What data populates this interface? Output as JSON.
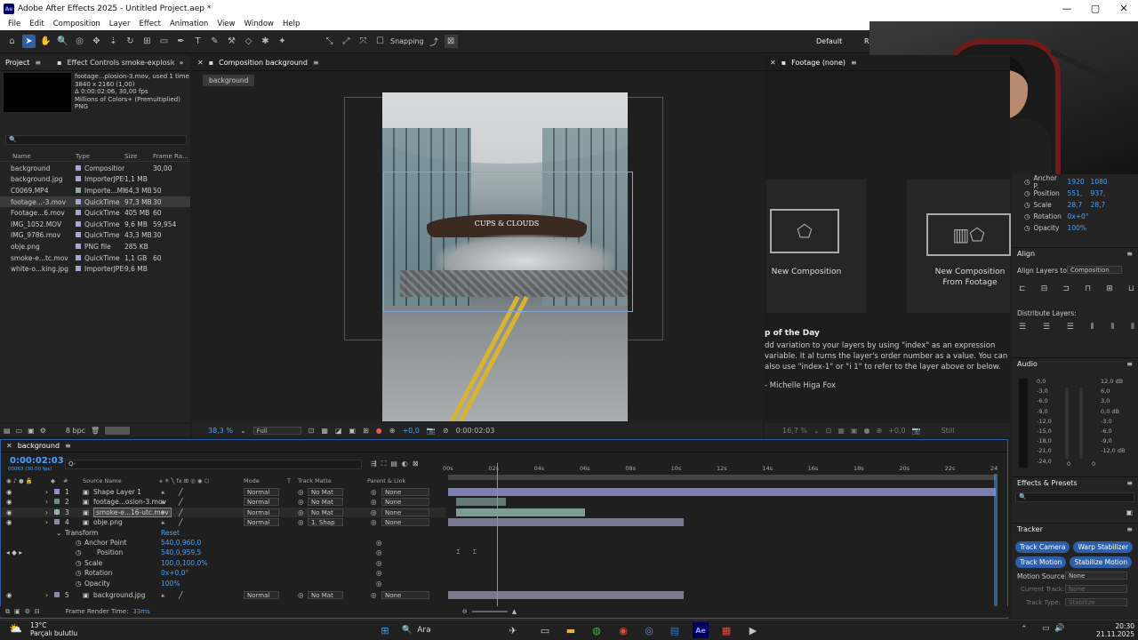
{
  "window": {
    "title": "Adobe After Effects 2025 - Untitled Project.aep *",
    "minimize": "—",
    "maximize": "▢",
    "close": "✕"
  },
  "menu": [
    "File",
    "Edit",
    "Composition",
    "Layer",
    "Effect",
    "Animation",
    "View",
    "Window",
    "Help"
  ],
  "toolbar": {
    "snapping": "Snapping",
    "workspace": "Default",
    "workspace_more": "R"
  },
  "project": {
    "tab_project": "Project",
    "tab_effects": "Effect Controls smoke-explosion-202",
    "preview_name": "footage...plosion-3.mov",
    "preview_used": ", used 1 time",
    "preview_dims": "3840 x 2160 (1,00)",
    "preview_duration": "Δ 0:00:02:06, 30,00 fps",
    "preview_colors": "Millions of Colors+ (Premultiplied)",
    "preview_format": "PNG",
    "search_placeholder": "🔍",
    "columns": [
      "Name",
      "Type",
      "Size",
      "Frame Ra..."
    ],
    "items": [
      {
        "name": "background",
        "type": "Composition",
        "size": "",
        "fps": "30,00",
        "color": "#a6a6d6"
      },
      {
        "name": "background.jpg",
        "type": "ImporterJPEG",
        "size": "1,1 MB",
        "fps": "",
        "color": "#a6a6d6"
      },
      {
        "name": "C0069.MP4",
        "type": "Importe...MEX",
        "size": "64,3 MB",
        "fps": "50",
        "color": "#8fa6a6"
      },
      {
        "name": "footage...-3.mov",
        "type": "QuickTime",
        "size": "97,3 MB",
        "fps": "30",
        "color": "#a6a6d6"
      },
      {
        "name": "Footage...6.mov",
        "type": "QuickTime",
        "size": "405 MB",
        "fps": "60",
        "color": "#a6a6d6"
      },
      {
        "name": "IMG_1052.MOV",
        "type": "QuickTime",
        "size": "9,6 MB",
        "fps": "59,954",
        "color": "#a6a6d6"
      },
      {
        "name": "IMG_9786.mov",
        "type": "QuickTime",
        "size": "43,3 MB",
        "fps": "30",
        "color": "#a6a6d6"
      },
      {
        "name": "obje.png",
        "type": "PNG file",
        "size": "285 KB",
        "fps": "",
        "color": "#a6a6d6"
      },
      {
        "name": "smoke-e...tc.mov",
        "type": "QuickTime",
        "size": "1,1 GB",
        "fps": "60",
        "color": "#a6a6d6"
      },
      {
        "name": "white-o...king.jpg",
        "type": "ImporterJPEG",
        "size": "9,6 MB",
        "fps": "",
        "color": "#a6a6d6"
      }
    ],
    "bpc": "8 bpc"
  },
  "composition": {
    "tab": "Composition background",
    "breadcrumb": "background",
    "sign": "CUPS & CLOUDS",
    "zoom": "38,3 %",
    "quality": "Full",
    "exposure": "+0,0",
    "timecode": "0:00:02:03"
  },
  "footage_panel": {
    "tab": "Footage (none)",
    "new_comp": "New Composition",
    "new_comp_footage": "New Composition From Footage",
    "tip_title": "p of the Day",
    "tip_text": "dd variation to your layers by using \"index\" as an expression variable. It al turns the layer's order number as a value. You can also use \"index-1\" or \"i 1\" to refer to the layer above or below.",
    "tip_author": "- Michelle Higa Fox",
    "zoom": "16,7 %",
    "exposure": "+0,0",
    "still": "Still"
  },
  "right_panel": {
    "props": [
      {
        "label": "Anchor P.",
        "v1": "1920",
        "v2": "1080"
      },
      {
        "label": "Position",
        "v1": "551,",
        "v2": "937,"
      },
      {
        "label": "Scale",
        "v1": "28,7",
        "v2": "28,7"
      },
      {
        "label": "Rotation",
        "v1": "0x+0°",
        "v2": ""
      },
      {
        "label": "Opacity",
        "v1": "100%",
        "v2": ""
      }
    ],
    "align_title": "Align",
    "align_layers_to": "Align Layers to:",
    "align_target": "Composition",
    "distribute": "Distribute Layers:",
    "audio_title": "Audio",
    "audio_left": [
      "0,0",
      "-3,0",
      "-6,0",
      "-9,0",
      "-12,0",
      "-15,0",
      "-18,0",
      "-21,0",
      "-24,0"
    ],
    "audio_right": [
      "12,0 dB",
      "6,0",
      "3,0",
      "0,0 dB",
      "-3,0",
      "-6,0",
      "-9,0",
      "-12,0 dB"
    ],
    "audio_zero_l": "0",
    "audio_zero_r": "0",
    "effects_title": "Effects & Presets",
    "effects_search": "🔍",
    "tracker_title": "Tracker",
    "track_camera": "Track Camera",
    "warp_stabilizer": "Warp Stabilizer",
    "track_motion": "Track Motion",
    "stabilize_motion": "Stabilize Motion",
    "motion_source": "Motion Source:",
    "motion_source_value": "None",
    "current_track": "Current Track:",
    "current_track_value": "None",
    "track_type": "Track Type:",
    "track_type_value": "Stabilize"
  },
  "timeline": {
    "tab": "background",
    "timecode": "0:00:02:03",
    "timecode_sub": "00063 (30.00 fps)",
    "search": "Q-",
    "col_source": "Source Name",
    "col_mode": "Mode",
    "col_t": "T",
    "col_matte": "Track Matte",
    "col_parent": "Parent & Link",
    "ruler": [
      "00s",
      "02s",
      "04s",
      "06s",
      "08s",
      "10s",
      "12s",
      "14s",
      "16s",
      "18s",
      "20s",
      "22s",
      "24"
    ],
    "playhead_pct": 0.089,
    "layers": [
      {
        "num": "1",
        "name": "Shape Layer 1",
        "mode": "Normal",
        "matte": "No Mat",
        "parent": "None",
        "color": "#8f8fd0",
        "start": 0.0,
        "end": 1.0
      },
      {
        "num": "2",
        "name": "footage...osion-3.mov",
        "mode": "Normal",
        "matte": "No Mat",
        "parent": "None",
        "color": "#6e8a86",
        "start": 0.015,
        "end": 0.105
      },
      {
        "num": "3",
        "name": "smoke-e...16-utc.mov",
        "mode": "Normal",
        "matte": "No Mat",
        "parent": "None",
        "color": "#8fb3a6",
        "start": 0.015,
        "end": 0.25
      },
      {
        "num": "4",
        "name": "obje.png",
        "mode": "Normal",
        "matte": "1. Shap",
        "parent": "None",
        "color": "#8a8aa6",
        "start": 0.0,
        "end": 0.43
      }
    ],
    "transform": "Transform",
    "reset": "Reset",
    "props": [
      {
        "name": "Anchor Point",
        "value": "540,0,960,0"
      },
      {
        "name": "Position",
        "value": "540,0,959,5"
      },
      {
        "name": "Scale",
        "value": "100,0,100,0%"
      },
      {
        "name": "Rotation",
        "value": "0x+0,0°"
      },
      {
        "name": "Opacity",
        "value": "100%"
      }
    ],
    "layer5": {
      "num": "5",
      "name": "background.jpg",
      "mode": "Normal",
      "matte": "No Mat",
      "parent": "None",
      "color": "#8a8aa6",
      "start": 0.0,
      "end": 0.43
    },
    "render_time_label": "Frame Render Time:",
    "render_time": "33ms"
  },
  "taskbar": {
    "weather_temp": "13°C",
    "weather_text": "Parçalı bulutlu",
    "search": "Ara",
    "time": "20:30",
    "date": "21.11.2025"
  }
}
